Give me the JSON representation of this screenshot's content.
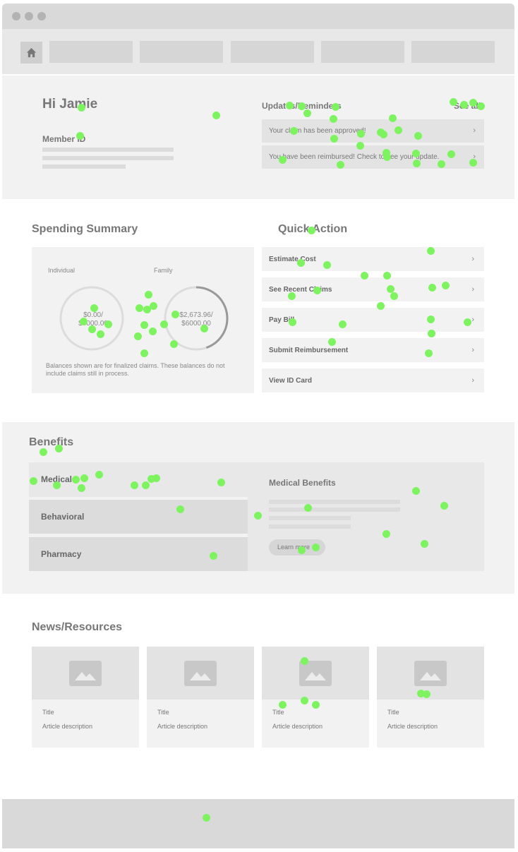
{
  "greeting": "Hi Jamie",
  "member_id_label": "Member ID",
  "updates": {
    "title": "Updates/Reminders",
    "see_all": "See all",
    "items": [
      {
        "text": "Your claim has been approved!"
      },
      {
        "text": "You have been reimbursed! Check to see your update."
      }
    ]
  },
  "spending": {
    "title": "Spending Summary",
    "individual_label": "Individual",
    "family_label": "Family",
    "individual_amount": "$0.00/",
    "individual_total": "$5000.00",
    "individual_fraction": 0.0,
    "family_amount": "$2,673.96/",
    "family_total": "$6000.00",
    "family_fraction": 0.446,
    "note": "Balances shown are for finalized claims. These balances do not include claims still in process."
  },
  "quick_action": {
    "title": "Quick Action",
    "items": [
      {
        "label": "Estimate Cost"
      },
      {
        "label": "See Recent Claims"
      },
      {
        "label": "Pay Bill"
      },
      {
        "label": "Submit Reimbursement"
      },
      {
        "label": "View ID Card"
      }
    ]
  },
  "benefits": {
    "title": "Benefits",
    "tabs": [
      {
        "label": "Medical"
      },
      {
        "label": "Behavioral"
      },
      {
        "label": "Pharmacy"
      }
    ],
    "panel_title": "Medical Benefits",
    "learn_more": "Learn more"
  },
  "news": {
    "title": "News/Resources",
    "cards": [
      {
        "title": "Title",
        "description": "Article description"
      },
      {
        "title": "Title",
        "description": "Article description"
      },
      {
        "title": "Title",
        "description": "Article description"
      },
      {
        "title": "Title",
        "description": "Article description"
      }
    ]
  },
  "chevron": "›",
  "colors": {
    "gaze_marker": "#7df45f",
    "ring": "#999999",
    "ring_track": "#dcdcdc"
  }
}
